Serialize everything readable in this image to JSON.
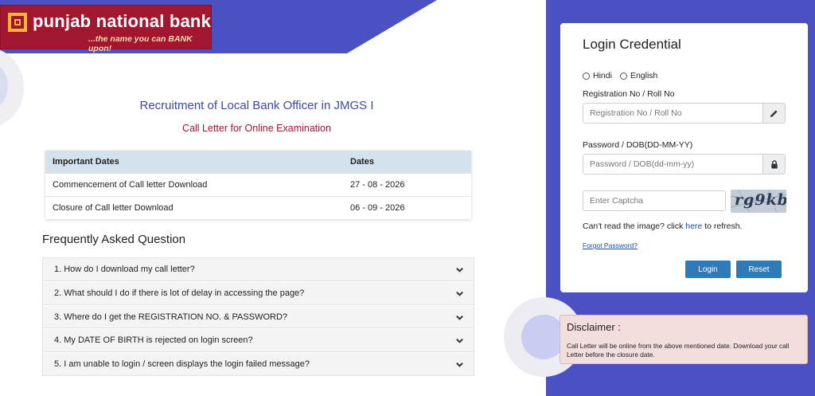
{
  "brand": {
    "name": "punjab national bank",
    "tagline": "...the name you can BANK upon!",
    "color": "#a3162f"
  },
  "header": {
    "recruitment_title": "Recruitment of Local Bank Officer in JMGS I",
    "sub_title": "Call Letter for Online Examination"
  },
  "dates_table": {
    "headers": [
      "Important Dates",
      "Dates"
    ],
    "rows": [
      [
        "Commencement of Call letter Download",
        "27 - 08 - 2026"
      ],
      [
        "Closure of Call letter Download",
        "06 - 09 - 2026"
      ]
    ]
  },
  "faq": {
    "title": "Frequently Asked Question",
    "items": [
      "1. How do I download my call letter?",
      "2. What should I do if there is lot of delay in accessing the page?",
      "3. Where do I get the REGISTRATION NO. & PASSWORD?",
      "4. My DATE OF BIRTH is rejected on login screen?",
      "5. I am unable to login / screen displays the login failed message?"
    ]
  },
  "login": {
    "title": "Login Credential",
    "languages": [
      "Hindi",
      "English"
    ],
    "registration_label": "Registration No / Roll No",
    "registration_placeholder": "Registration No / Roll No",
    "password_label": "Password / DOB(DD-MM-YY)",
    "password_placeholder": "Password / DOB(dd-mm-yy)",
    "captcha_placeholder": "Enter Captcha",
    "captcha_text": "rg9kb",
    "refresh_prefix": "Can't read the image? click ",
    "refresh_link": "here",
    "refresh_suffix": " to refresh.",
    "forgot_password": "Forgot Password?",
    "login_button": "Login",
    "reset_button": "Reset",
    "accent_color": "#4a51c2"
  },
  "disclaimer": {
    "title": "Disclaimer :",
    "text": "Call Letter will be online from the above mentioned date. Download your call Letter before the closure date."
  }
}
